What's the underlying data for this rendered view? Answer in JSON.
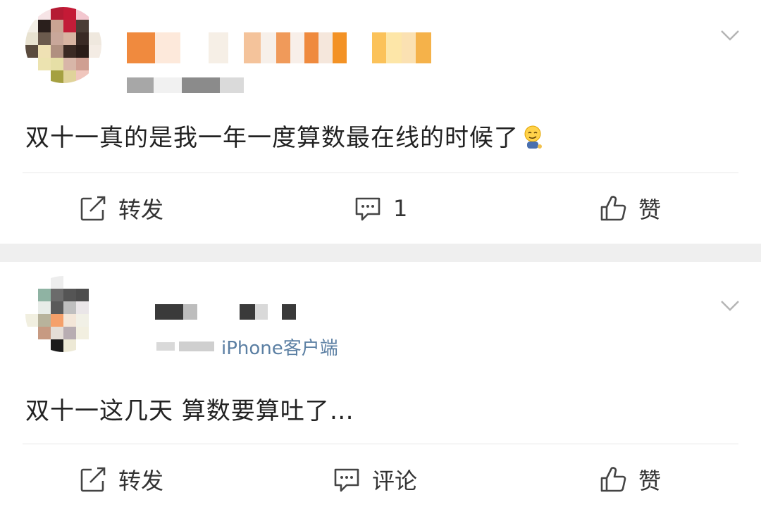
{
  "colors": {
    "page_bg": "#ffffff",
    "separator": "#efefef",
    "text": "#222222",
    "action_text": "#333333",
    "link": "#5b7fa3"
  },
  "posts": [
    {
      "content": "双十一真的是我一年一度算数最在线的时候了",
      "emoji": "smirk-emoji",
      "actions": {
        "repost": "转发",
        "comment": "1",
        "like": "赞"
      }
    },
    {
      "meta_source": "iPhone客户端",
      "content": "双十一这几天 算数要算吐了…",
      "actions": {
        "repost": "转发",
        "comment": "评论",
        "like": "赞"
      }
    }
  ]
}
